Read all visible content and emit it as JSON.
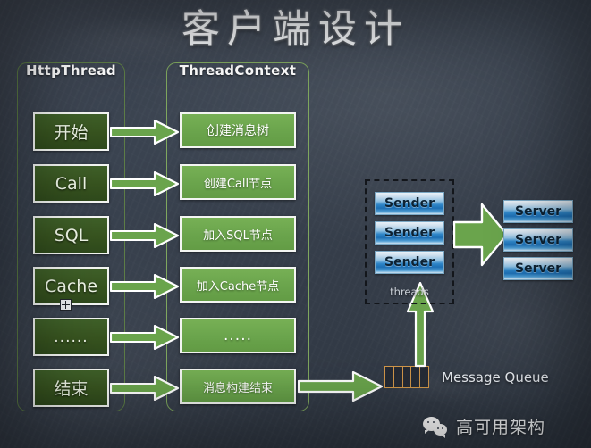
{
  "slide": {
    "title": "客户端设计",
    "background_color": "#3a4350"
  },
  "columns": {
    "http_thread": {
      "title": "HttpThread",
      "border_color": "#5d7d46",
      "nodes": [
        {
          "label": "开始"
        },
        {
          "label": "Call"
        },
        {
          "label": "SQL"
        },
        {
          "label": "Cache"
        },
        {
          "label": "......"
        },
        {
          "label": "结束"
        }
      ]
    },
    "thread_context": {
      "title": "ThreadContext",
      "border_color": "#7fa75e",
      "nodes": [
        {
          "label": "创建消息树"
        },
        {
          "label": "创建Call节点"
        },
        {
          "label": "加入SQL节点"
        },
        {
          "label": "加入Cache节点"
        },
        {
          "label": "....."
        },
        {
          "label": "消息构建结束"
        }
      ]
    }
  },
  "threads_group": {
    "label": "threads",
    "senders": [
      "Sender",
      "Sender",
      "Sender"
    ]
  },
  "servers": [
    "Server",
    "Server",
    "Server"
  ],
  "message_queue": {
    "label": "Message Queue",
    "cell_count": 5,
    "border_color": "#d2974a"
  },
  "footer": {
    "account_name": "高可用架构",
    "icon": "wechat-icon"
  },
  "colors": {
    "node_dark_green": "#37531f",
    "node_bright_green": "#6aa44c",
    "arrow_green": "#6aa44c",
    "glass_blue": "#2f86c8"
  }
}
